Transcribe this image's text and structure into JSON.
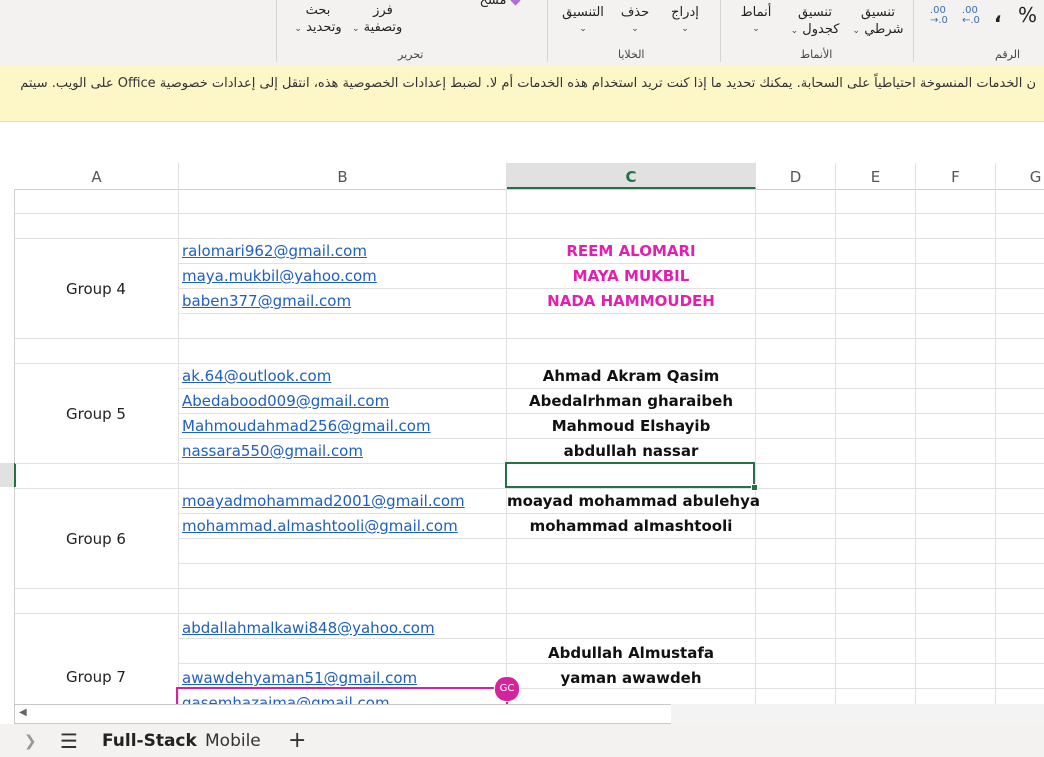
{
  "ribbon": {
    "number_group_label": "الرقم",
    "percent_icon": "percent-icon",
    "comma_glyph": "9",
    "styles_group_label": "الأنماط",
    "conditional_format_line1": "تنسيق",
    "conditional_format_line2": "شرطي",
    "format_table_line1": "تنسيق",
    "format_table_line2": "كجدول",
    "cell_styles": "أنماط",
    "cells_group_label": "الخلايا",
    "insert": "إدراج",
    "delete": "حذف",
    "format": "التنسيق",
    "editing_group_label": "تحرير",
    "sort_filter_line1": "فرز",
    "sort_filter_line2": "وتصفية",
    "find_select_line1": "بحث",
    "find_select_line2": "وتحديد",
    "clear": "مسح"
  },
  "banner": {
    "text": "ن الخدمات المنسوخة احتياطياً على السحابة. يمكنك تحديد ما إذا كنت تريد استخدام هذه الخدمات أم لا. لضبط إعدادات الخصوصية هذه، انتقل إلى إعدادات خصوصية Office على الويب. سيتم"
  },
  "columns": [
    "A",
    "B",
    "C",
    "D",
    "E",
    "F",
    "G"
  ],
  "groups": [
    {
      "label": "Group 4"
    },
    {
      "label": "Group 5"
    },
    {
      "label": "Group 6"
    },
    {
      "label": "Group 7"
    }
  ],
  "emails": [
    "ralomari962@gmail.com",
    "maya.mukbil@yahoo.com",
    "baben377@gmail.com",
    "ak.64@outlook.com",
    "Abedabood009@gmail.com",
    "Mahmoudahmad256@gmail.com",
    "nassara550@gmail.com",
    "moayadmohammad2001@gmail.com",
    "mohammad.almashtooli@gmail.com",
    "abdallahmalkawi848@yahoo.com",
    "awawdehyaman51@gmail.com",
    "qasemhazaima@gmail.com"
  ],
  "names": [
    "REEM ALOMARI",
    "MAYA MUKBIL",
    "NADA HAMMOUDEH",
    "Ahmad Akram Qasim",
    "Abedalrhman gharaibeh",
    "Mahmoud Elshayib",
    "abdullah nassar",
    "moayad mohammad abulehya",
    "mohammad almashtooli",
    "Abdullah Almustafa",
    "yaman awawdeh"
  ],
  "colors": {
    "accent_green": "#217346",
    "pink_names": "#e31fb0",
    "collaborator": "#d5239d",
    "link_blue": "#1f5fbf"
  },
  "collaborator": {
    "initials": "GC"
  },
  "sheet_tabs": {
    "active": "Full-Stack",
    "other": "Mobile",
    "add_icon": "plus-icon",
    "menu_icon": "hamburger-icon",
    "nav_icon": "chevron-right-icon"
  }
}
